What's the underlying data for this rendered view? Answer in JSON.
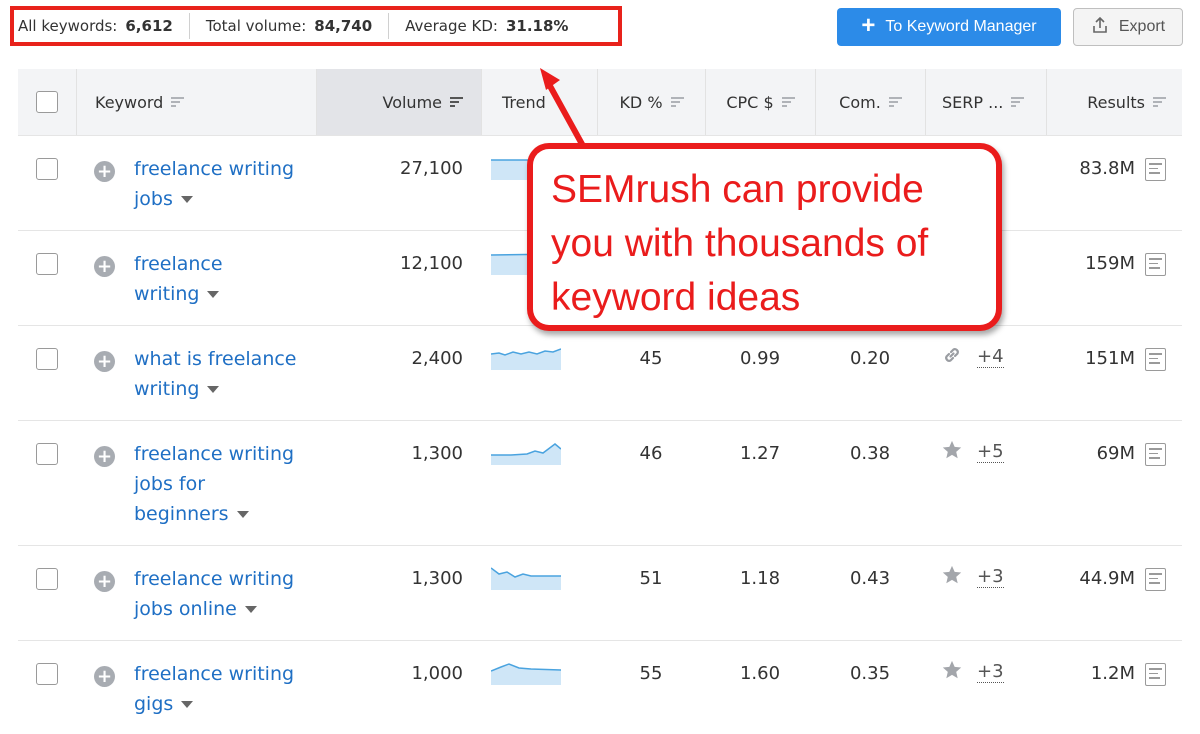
{
  "summary": {
    "all_keywords_label": "All keywords:",
    "all_keywords_value": "6,612",
    "total_volume_label": "Total volume:",
    "total_volume_value": "84,740",
    "avg_kd_label": "Average KD:",
    "avg_kd_value": "31.18%"
  },
  "toolbar": {
    "keyword_manager_label": "To Keyword Manager",
    "export_label": "Export"
  },
  "columns": {
    "keyword": "Keyword",
    "volume": "Volume",
    "trend": "Trend",
    "kd": "KD %",
    "cpc": "CPC $",
    "com": "Com.",
    "serp": "SERP ...",
    "results": "Results"
  },
  "rows": [
    {
      "kw1": "freelance writing",
      "kw2": "jobs",
      "kw3": "",
      "volume": "27,100",
      "kd": "",
      "cpc": "",
      "com": "",
      "serp_icon": "",
      "serp_more": "",
      "results": "83.8M"
    },
    {
      "kw1": "freelance",
      "kw2": "writing",
      "kw3": "",
      "volume": "12,100",
      "kd": "",
      "cpc": "",
      "com": "",
      "serp_icon": "",
      "serp_more": "",
      "results": "159M"
    },
    {
      "kw1": "what is freelance",
      "kw2": "writing",
      "kw3": "",
      "volume": "2,400",
      "kd": "45",
      "cpc": "0.99",
      "com": "0.20",
      "serp_icon": "link-icon",
      "serp_more": "+4",
      "results": "151M"
    },
    {
      "kw1": "freelance writing",
      "kw2": "jobs for",
      "kw3": "beginners",
      "volume": "1,300",
      "kd": "46",
      "cpc": "1.27",
      "com": "0.38",
      "serp_icon": "star-icon",
      "serp_more": "+5",
      "results": "69M"
    },
    {
      "kw1": "freelance writing",
      "kw2": "jobs online",
      "kw3": "",
      "volume": "1,300",
      "kd": "51",
      "cpc": "1.18",
      "com": "0.43",
      "serp_icon": "star-icon",
      "serp_more": "+3",
      "results": "44.9M"
    },
    {
      "kw1": "freelance writing",
      "kw2": "gigs",
      "kw3": "",
      "volume": "1,000",
      "kd": "55",
      "cpc": "1.60",
      "com": "0.35",
      "serp_icon": "star-icon",
      "serp_more": "+3",
      "results": "1.2M"
    }
  ],
  "callout": {
    "line1": "SEMrush can provide",
    "line2": "you with thousands of",
    "line3": "keyword ideas"
  },
  "colors": {
    "accent_red": "#ea1c1c",
    "link_blue": "#1f6fc4",
    "button_blue": "#2c8be8"
  }
}
